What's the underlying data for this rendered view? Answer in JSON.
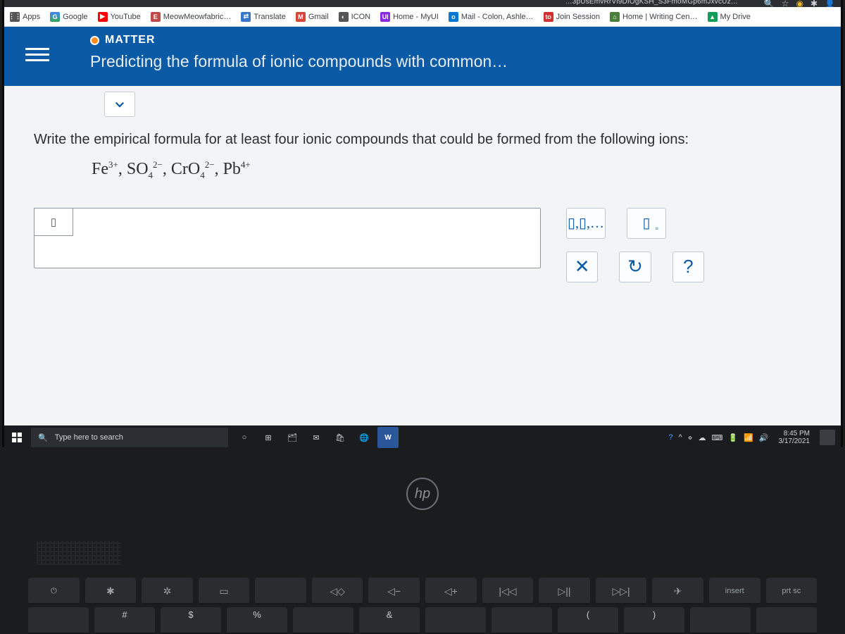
{
  "browser": {
    "url_fragment": "…3pUsEmvRrVl9DIOgKSH_S3FmoMGp6mJxvcUz…",
    "bookmarks": [
      {
        "label": "Apps",
        "icon": ""
      },
      {
        "label": "Google",
        "icon": "G",
        "cls": "g-ico"
      },
      {
        "label": "YouTube",
        "icon": "▶",
        "cls": "yt-ico"
      },
      {
        "label": "MeowMeowfabric…",
        "icon": "E",
        "cls": "mw-ico"
      },
      {
        "label": "Translate",
        "icon": "⇄",
        "cls": "tr-ico"
      },
      {
        "label": "Gmail",
        "icon": "M",
        "cls": "gm-ico"
      },
      {
        "label": "ICON",
        "icon": "◐",
        "cls": "ic-ico"
      },
      {
        "label": "Home - MyUI",
        "icon": "UI",
        "cls": "hm-ico"
      },
      {
        "label": "Mail - Colon, Ashle…",
        "icon": "o",
        "cls": "ml-ico"
      },
      {
        "label": "Join Session",
        "icon": "to",
        "cls": "js-ico"
      },
      {
        "label": "Home | Writing Cen…",
        "icon": "⌂",
        "cls": "wc-ico"
      },
      {
        "label": "My Drive",
        "icon": "▲",
        "cls": "md-ico"
      }
    ]
  },
  "header": {
    "category": "MATTER",
    "title": "Predicting the formula of ionic compounds with common…"
  },
  "content": {
    "prompt": "Write the empirical formula for at least four ionic compounds that could be formed from the following ions:",
    "ions_html": "Fe<sup>3+</sup>, SO<sub>4</sub><sup>2−</sup>, CrO<sub>4</sub><sup>2−</sup>, Pb<sup>4+</sup>",
    "answer_placeholder": "▯",
    "tools": {
      "format_list": "▯,▯,…",
      "subscript": "▯",
      "subscript_small": "▫",
      "clear": "✕",
      "undo": "↻",
      "help": "?"
    }
  },
  "taskbar": {
    "search_placeholder": "Type here to search",
    "time": "8:45 PM",
    "date": "3/17/2021"
  },
  "keyboard": {
    "fn": [
      "",
      "✱",
      "✲",
      "▭",
      "",
      "◁◇",
      "◁−",
      "◁+",
      "|◁◁",
      "▷||",
      "▷▷|",
      "✈",
      "insert",
      "prt sc"
    ],
    "num": [
      "",
      "#",
      "$",
      "%",
      "",
      "&",
      "",
      "",
      "(",
      ")",
      "",
      ""
    ]
  }
}
